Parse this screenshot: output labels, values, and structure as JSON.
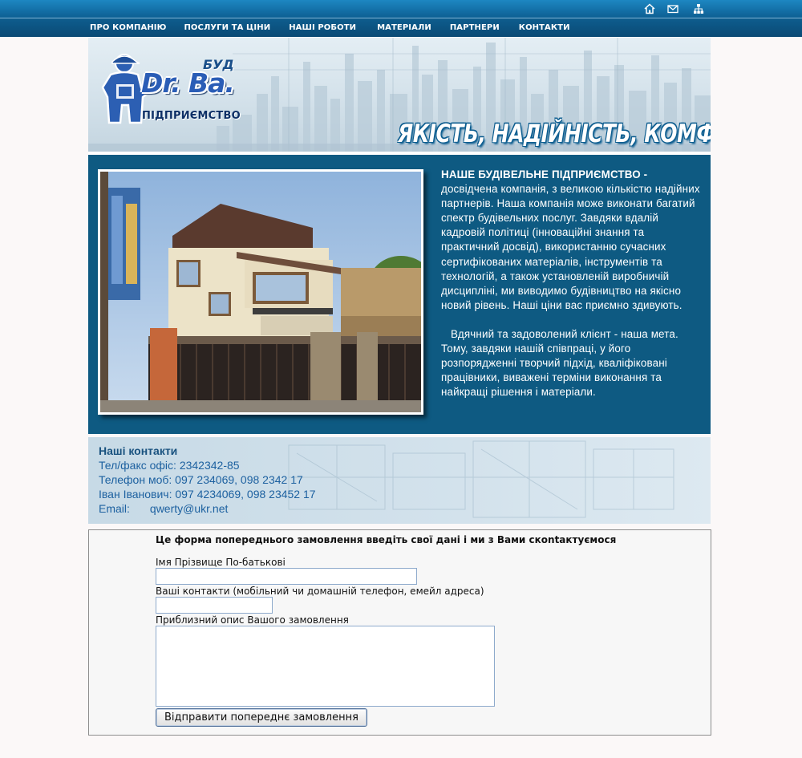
{
  "topbar": {
    "icons": [
      "home-icon",
      "mail-icon",
      "sitemap-icon"
    ]
  },
  "nav": {
    "items": [
      {
        "label": "ПРО КОМПАНІЮ"
      },
      {
        "label": "ПОСЛУГИ ТА ЦІНИ"
      },
      {
        "label": "НАШІ РОБОТИ"
      },
      {
        "label": "МАТЕРІАЛИ"
      },
      {
        "label": "ПАРТНЕРИ"
      },
      {
        "label": "КОНТАКТИ"
      }
    ]
  },
  "header": {
    "logo_bud": "БУД",
    "logo_name": "Dr. Ba.",
    "logo_sub": "ПІДПРИЄМСТВО",
    "slogan": "ЯКІСТЬ, НАДІЙНІСТЬ, КОМФОРТ"
  },
  "intro": {
    "lead": "НАШЕ БУДІВЕЛЬНЕ ПІДПРИЄМСТВО -",
    "paragraph1": "досвідчена компанія, з великою кількістю надійних партнерів. Наша компанія може виконати багатий спектр будівельних послуг. Завдяки вдалій кадровій політиці (інноваційні знання та практичний досвід), використанню сучасних сертифікованих матеріалів, інструментів та технологій, а також установленій виробничій дисципліні, ми виводимо будівництво на якісно новий рівень. Наші ціни вас приємно здивують.",
    "paragraph2": "Вдячний та задоволений клієнт - наша мета. Тому, завдяки нашій співпраці, у його розпорядженні творчий підхід, кваліфіковані працівники, виважені терміни виконання та найкращі рішення і матеріали."
  },
  "contacts": {
    "title": "Наші контакти",
    "rows": [
      "Тел/факс офіс: 2342342-85",
      "Телефон моб:  097 234069, 098 2342 17",
      "Іван Іванович: 097 4234069, 098 23452 17"
    ],
    "email_label": "Email:",
    "email_value": "qwerty@ukr.net"
  },
  "form": {
    "heading": "Це форма попереднього замовлення введіть свої дані і ми з Вами скontактуємося",
    "name_label": "Імя Прізвище По-батькові",
    "name_value": "",
    "contacts_label": "Ваші контакти (мобільний чи домашній телефон, емейл адреса)",
    "contacts_value": "",
    "description_label": "Приблизний опис Вашого замовлення",
    "description_value": "",
    "submit_label": "Відправити попереднє замовлення"
  }
}
